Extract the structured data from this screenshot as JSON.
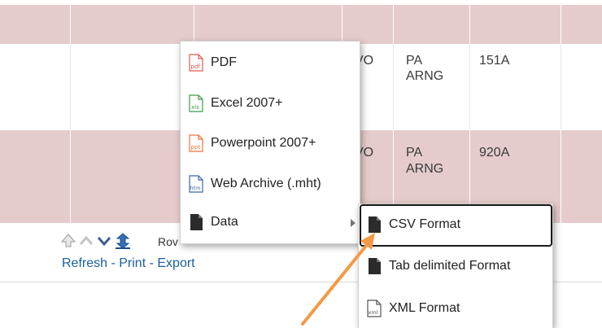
{
  "table": {
    "rows": [
      {
        "col1": "VO",
        "col2a": "PA",
        "col2b": "ARNG",
        "col3": "151A"
      },
      {
        "col1": "VO",
        "col2a": "PA",
        "col2b": "ARNG",
        "col3": "920A"
      }
    ]
  },
  "pager": {
    "label": "Rov"
  },
  "links": {
    "refresh": "Refresh",
    "print": "Print",
    "export": "Export",
    "separator": " - "
  },
  "export_menu": {
    "items": [
      {
        "label": "PDF",
        "icon": "pdf-file-icon"
      },
      {
        "label": "Excel 2007+",
        "icon": "xls-file-icon"
      },
      {
        "label": "Powerpoint 2007+",
        "icon": "ppt-file-icon"
      },
      {
        "label": "Web Archive (.mht)",
        "icon": "htm-file-icon"
      },
      {
        "label": "Data",
        "icon": "data-file-icon"
      }
    ]
  },
  "data_submenu": {
    "items": [
      {
        "label": "CSV Format",
        "icon": "csv-file-icon"
      },
      {
        "label": "Tab delimited Format",
        "icon": "tab-file-icon"
      },
      {
        "label": "XML Format",
        "icon": "xml-file-icon"
      }
    ]
  },
  "colors": {
    "row_pink": "#e6cbcc",
    "link": "#1a5f9c",
    "arrow": "#f39a45"
  }
}
